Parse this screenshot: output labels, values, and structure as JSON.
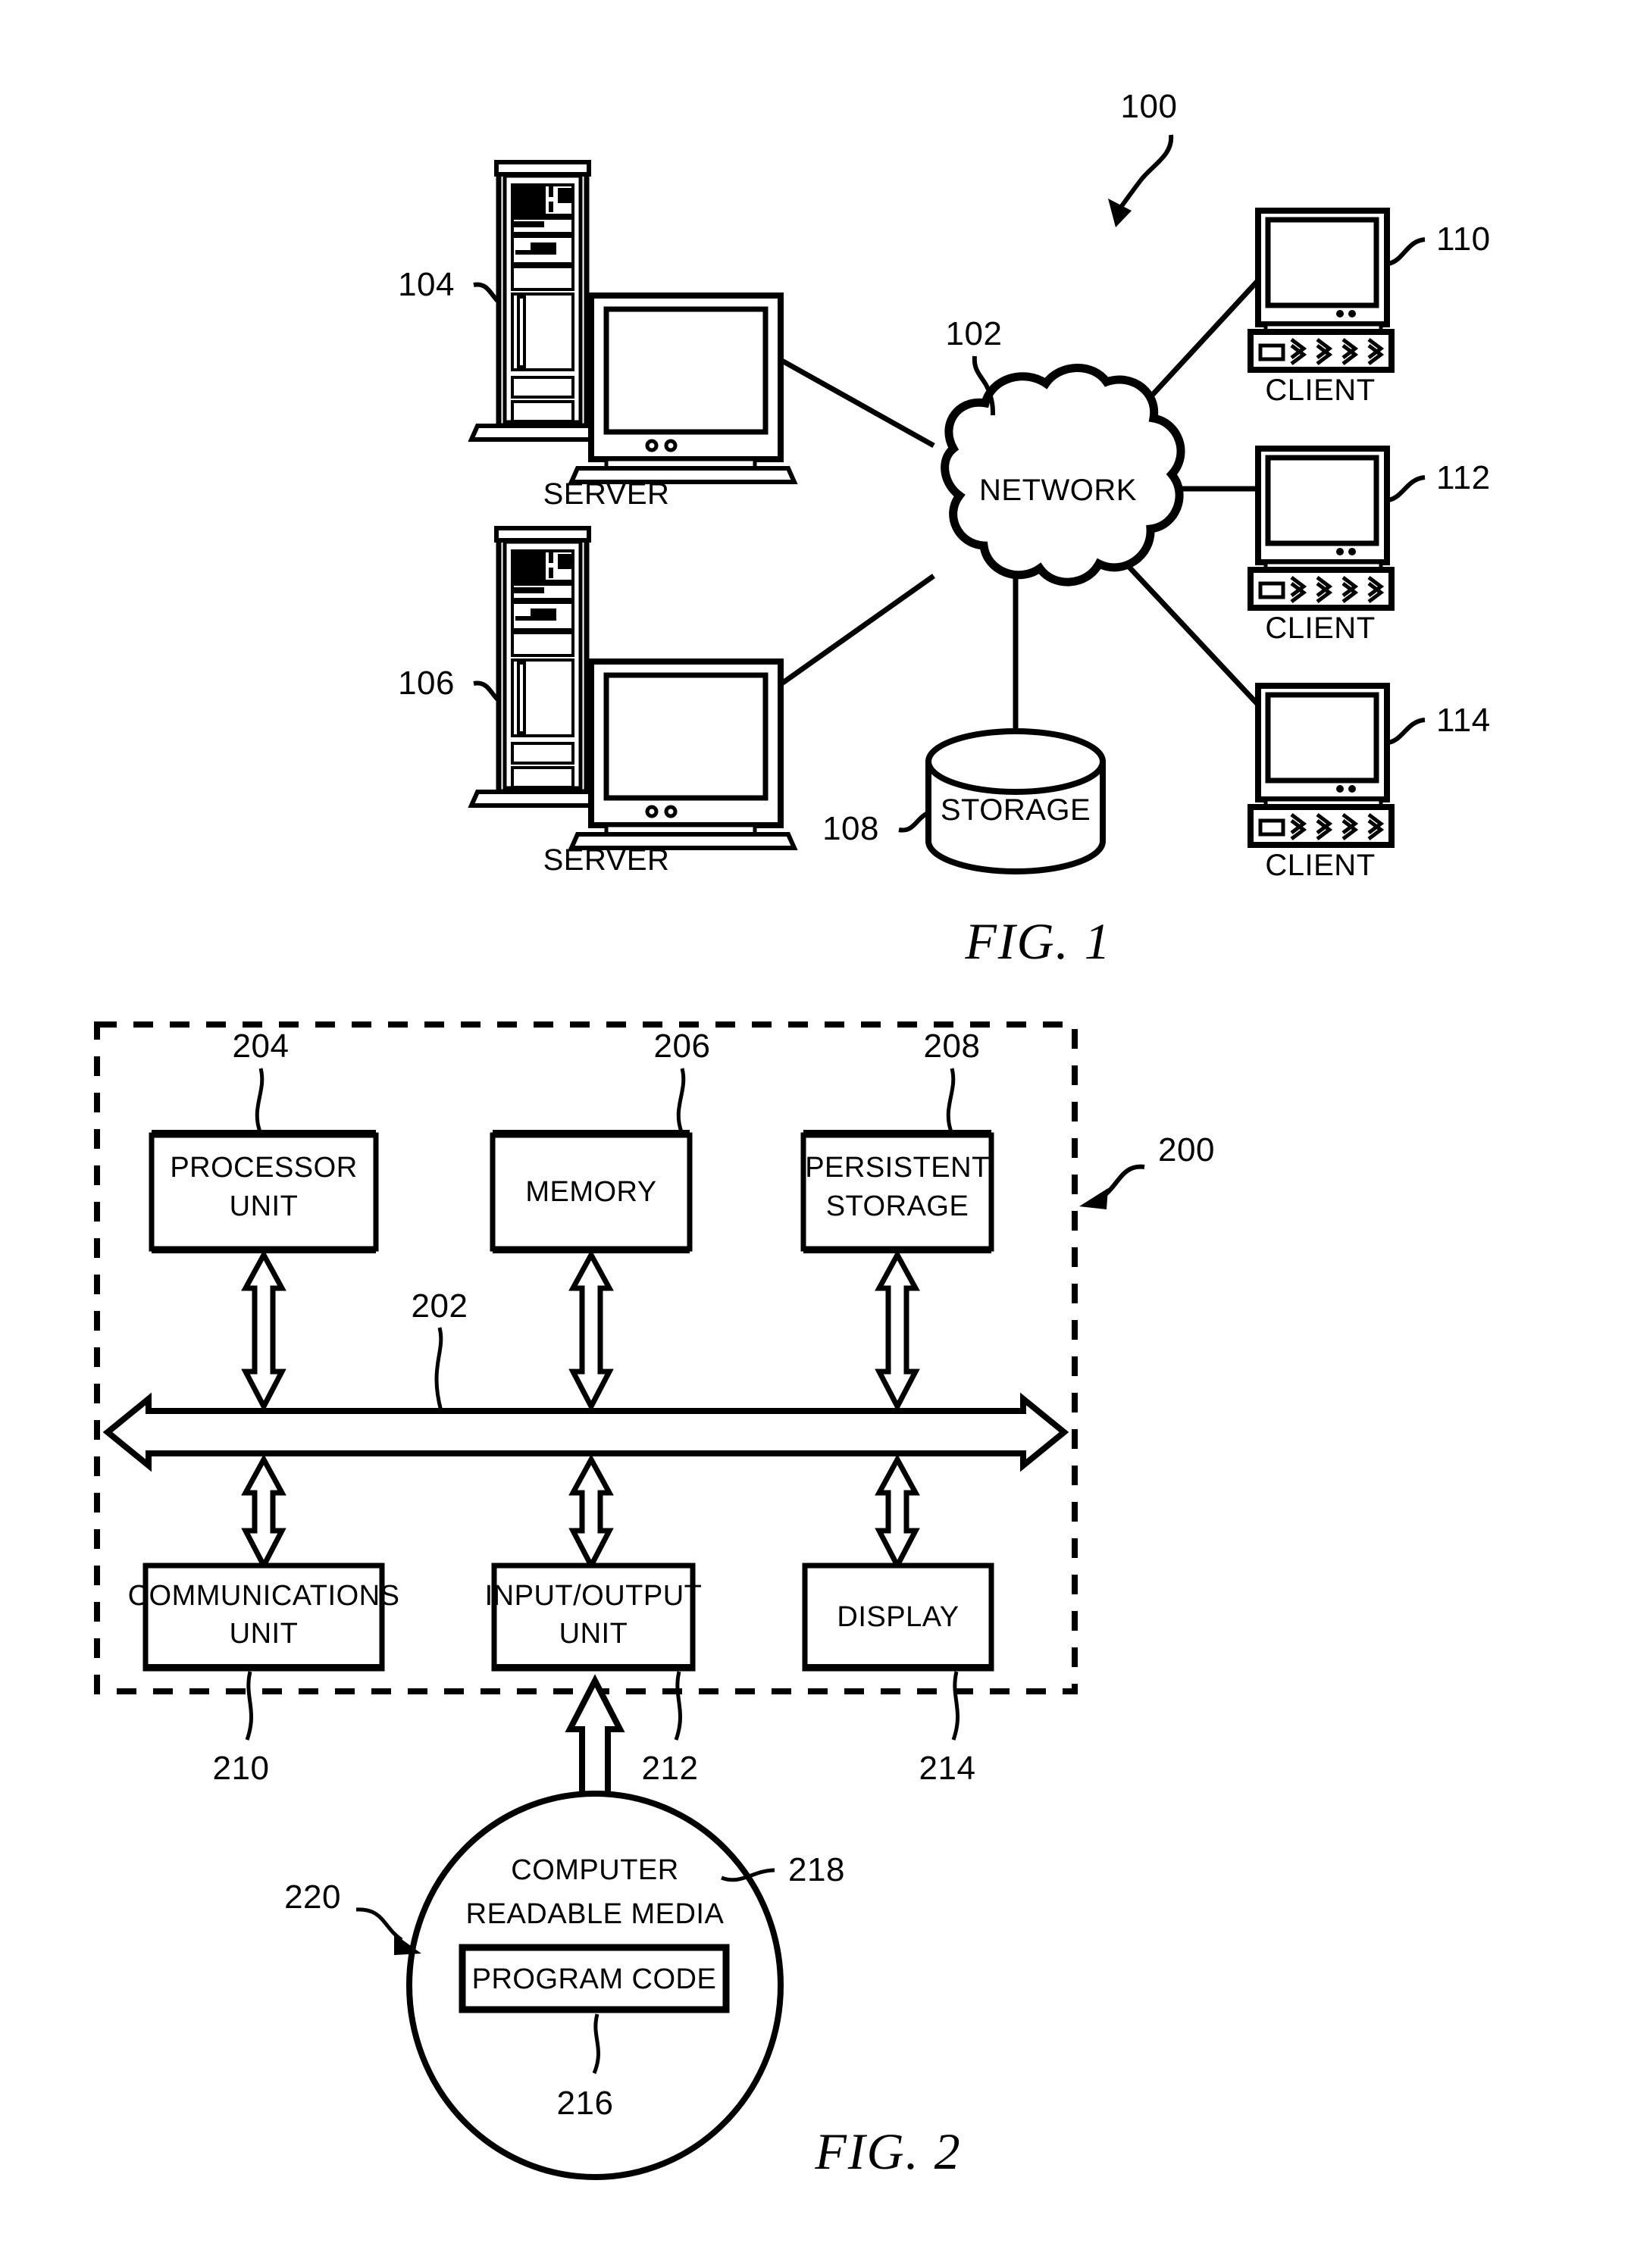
{
  "figures": [
    {
      "id": "fig1",
      "caption": "FIG. 1",
      "system_ref": "100",
      "nodes": {
        "server_top": {
          "label": "SERVER",
          "ref": "104"
        },
        "server_bottom": {
          "label": "SERVER",
          "ref": "106"
        },
        "network": {
          "label": "NETWORK",
          "ref": "102"
        },
        "storage": {
          "label": "STORAGE",
          "ref": "108"
        },
        "client_top": {
          "label": "CLIENT",
          "ref": "110"
        },
        "client_middle": {
          "label": "CLIENT",
          "ref": "112"
        },
        "client_bottom": {
          "label": "CLIENT",
          "ref": "114"
        }
      }
    },
    {
      "id": "fig2",
      "caption": "FIG. 2",
      "system_ref": "200",
      "bus": {
        "label": "",
        "ref": "202"
      },
      "top_boxes": [
        {
          "lines": [
            "PROCESSOR",
            "UNIT"
          ],
          "ref": "204"
        },
        {
          "lines": [
            "MEMORY"
          ],
          "ref": "206"
        },
        {
          "lines": [
            "PERSISTENT",
            "STORAGE"
          ],
          "ref": "208"
        }
      ],
      "bottom_boxes": [
        {
          "lines": [
            "COMMUNICATIONS",
            "UNIT"
          ],
          "ref": "210"
        },
        {
          "lines": [
            "INPUT/OUTPUT",
            "UNIT"
          ],
          "ref": "212"
        },
        {
          "lines": [
            "DISPLAY"
          ],
          "ref": "214"
        }
      ],
      "media": {
        "lines": [
          "COMPUTER",
          "READABLE MEDIA"
        ],
        "ref": "218",
        "product_ref": "220",
        "program_code": {
          "label": "PROGRAM CODE",
          "ref": "216"
        }
      }
    }
  ],
  "colors": {
    "ink": "#000000",
    "paper": "#ffffff"
  }
}
